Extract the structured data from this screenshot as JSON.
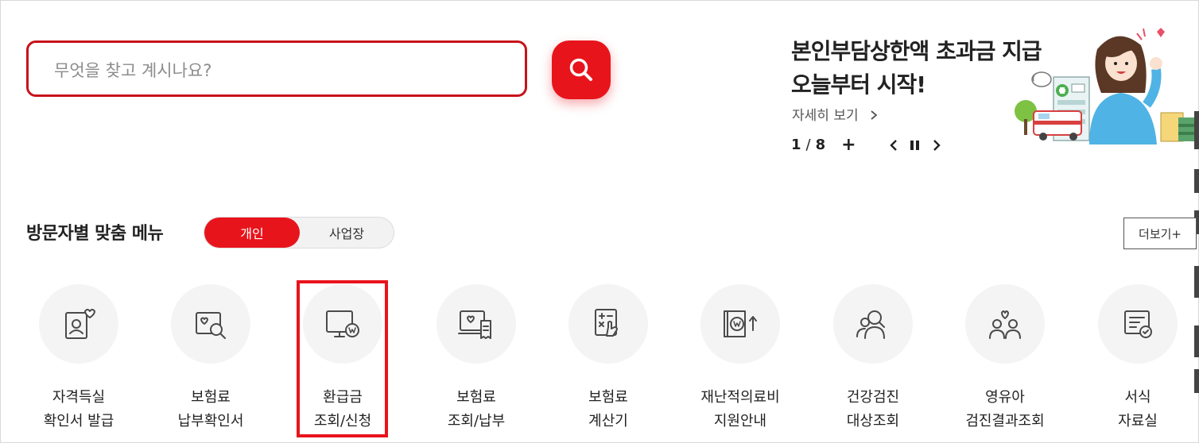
{
  "search": {
    "placeholder": "무엇을 찾고 계시나요?"
  },
  "banner": {
    "title_line1": "본인부담상한액 초과금 지급",
    "title_line2": "오늘부터 시작!",
    "link": "자세히 보기",
    "pager_current": "1",
    "pager_sep": "/",
    "pager_total": "8",
    "plus": "+"
  },
  "section": {
    "title": "방문자별 맞춤 메뉴",
    "tabs": [
      {
        "label": "개인",
        "active": true
      },
      {
        "label": "사업장",
        "active": false
      }
    ],
    "more_label": "더보기+"
  },
  "menu": [
    {
      "line1": "자격득실",
      "line2": "확인서 발급",
      "icon": "id-card-heart-icon"
    },
    {
      "line1": "보험료",
      "line2": "납부확인서",
      "icon": "document-search-icon"
    },
    {
      "line1": "환급금",
      "line2": "조회/신청",
      "icon": "monitor-won-icon"
    },
    {
      "line1": "보험료",
      "line2": "조회/납부",
      "icon": "computer-receipt-icon"
    },
    {
      "line1": "보험료",
      "line2": "계산기",
      "icon": "calculator-hand-icon"
    },
    {
      "line1": "재난적의료비",
      "line2": "지원안내",
      "icon": "book-won-arrow-icon"
    },
    {
      "line1": "건강검진",
      "line2": "대상조회",
      "icon": "people-search-icon"
    },
    {
      "line1": "영유아",
      "line2": "검진결과조회",
      "icon": "parent-child-icon"
    },
    {
      "line1": "서식",
      "line2": "자료실",
      "icon": "form-check-icon"
    }
  ],
  "colors": {
    "accent": "#e8141c",
    "search_border": "#c8121b",
    "circle_bg": "#f4f4f5",
    "icon_stroke": "#4a4a4a"
  }
}
